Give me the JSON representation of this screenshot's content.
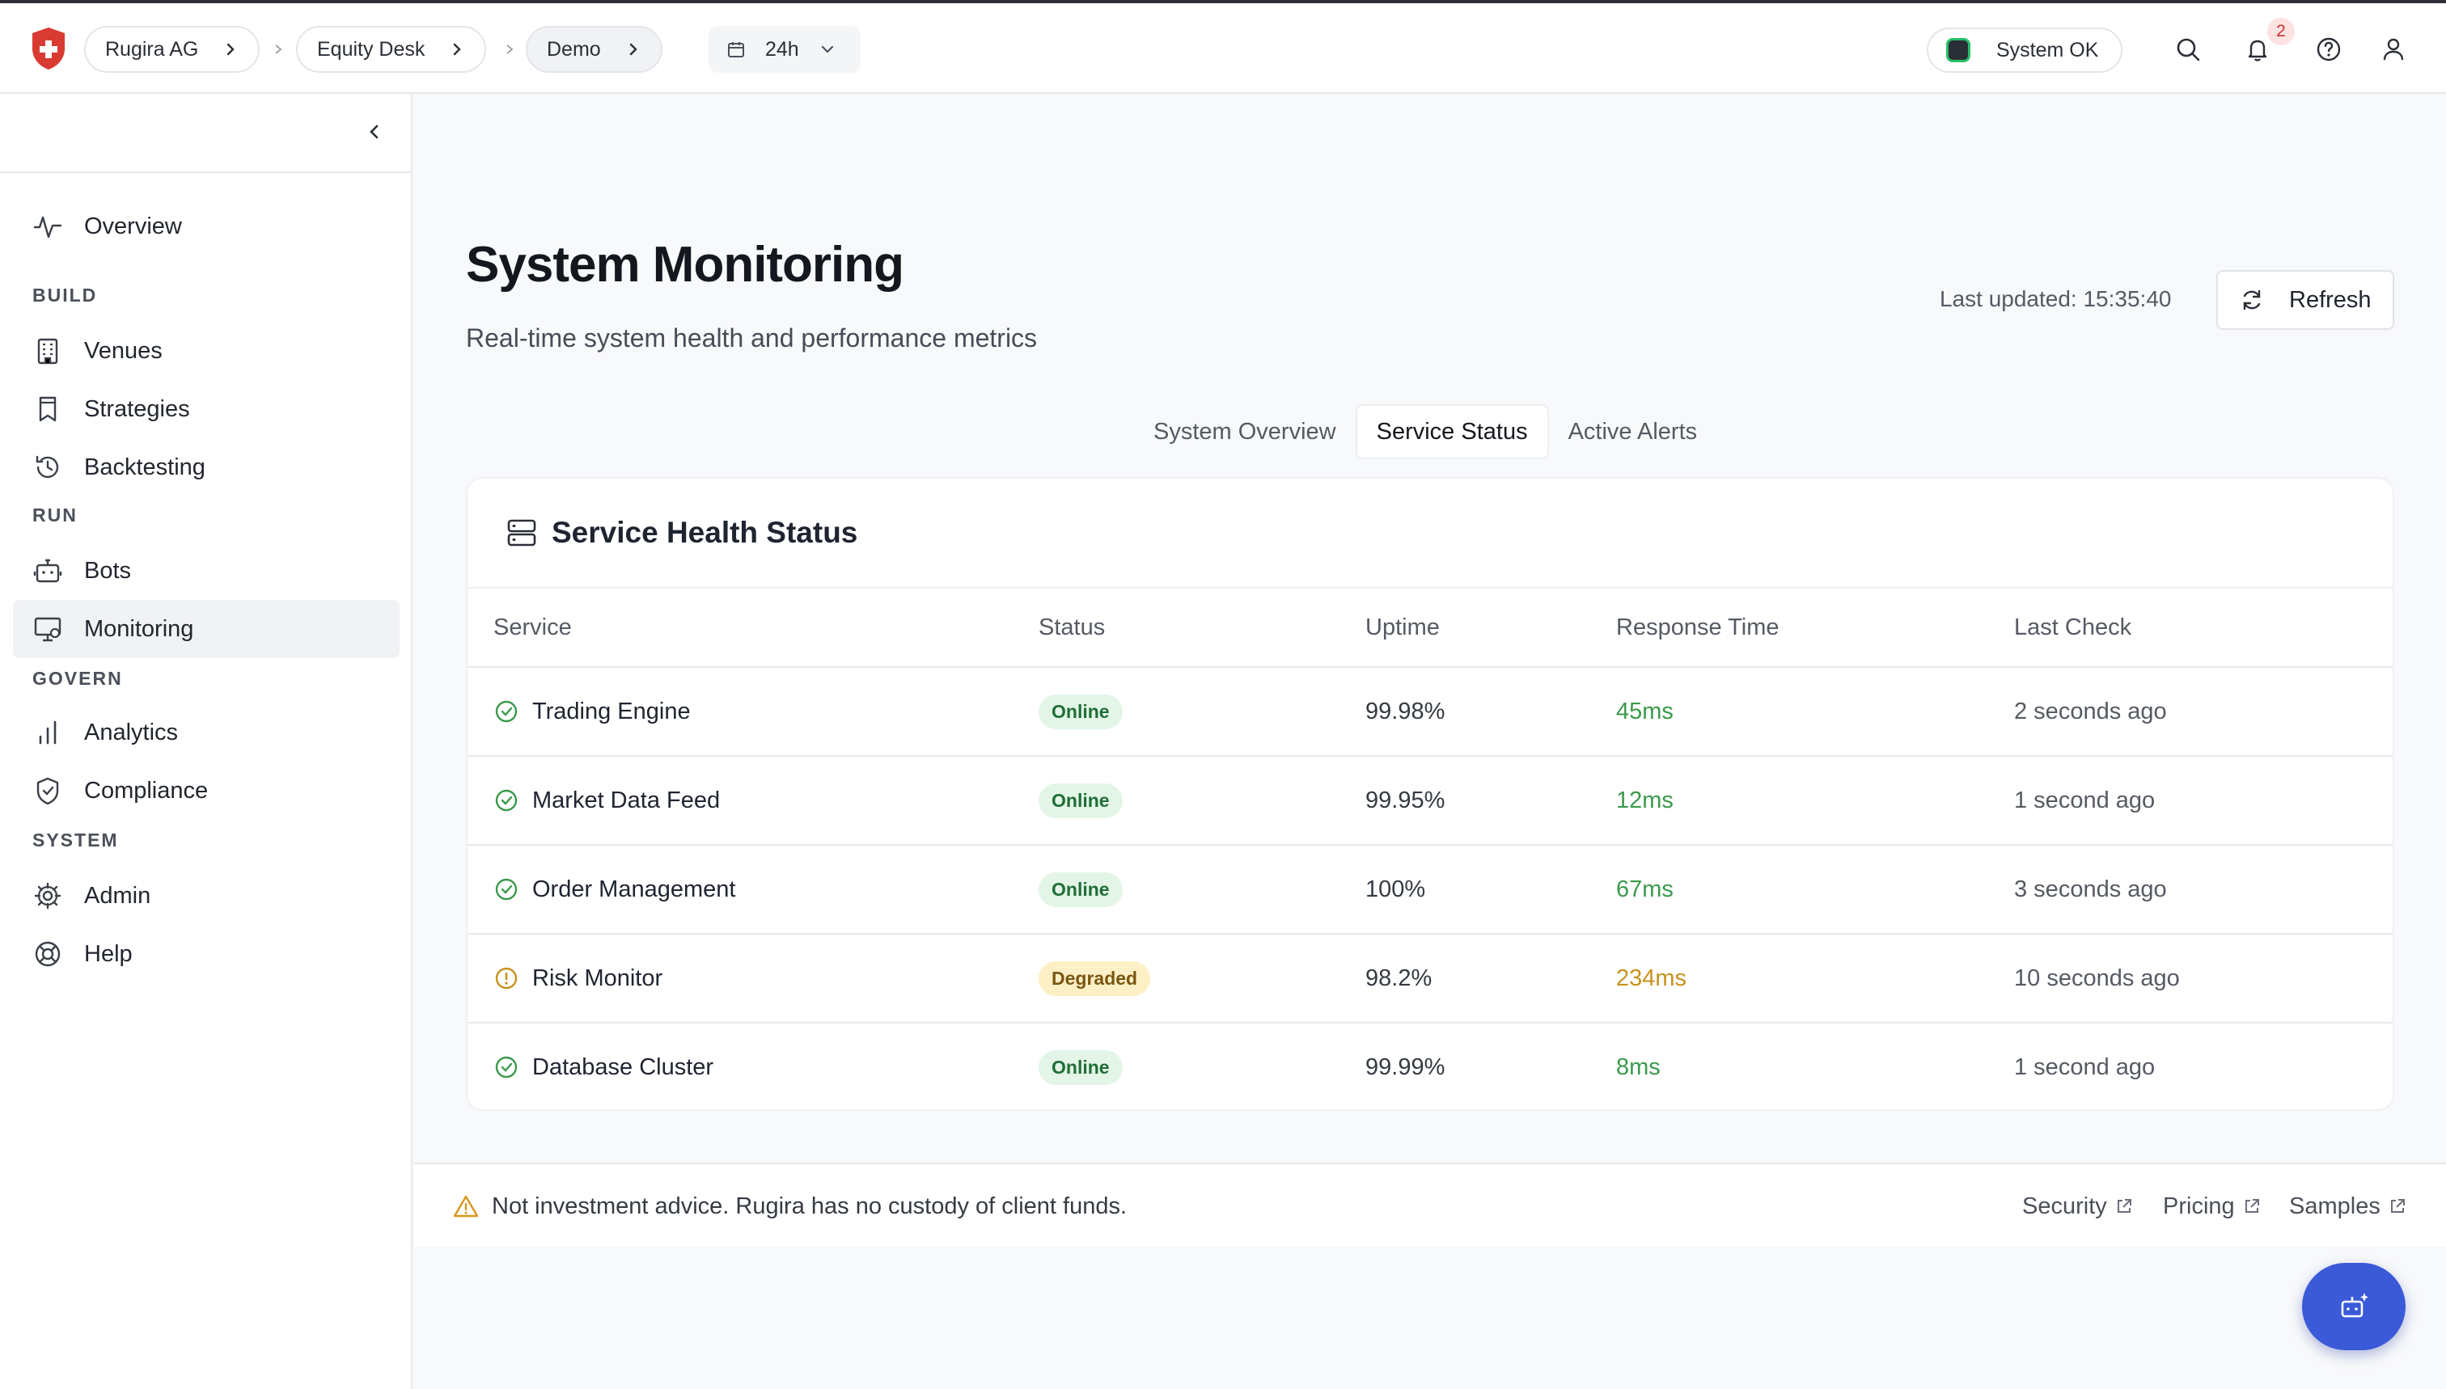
{
  "header": {
    "breadcrumbs": [
      "Rugira AG",
      "Equity Desk",
      "Demo"
    ],
    "time_range": "24h",
    "system_status": "System OK",
    "notification_count": "2"
  },
  "sidebar": {
    "overview": "Overview",
    "sections": {
      "build": "BUILD",
      "run": "RUN",
      "govern": "GOVERN",
      "system": "SYSTEM"
    },
    "items": {
      "venues": "Venues",
      "strategies": "Strategies",
      "backtesting": "Backtesting",
      "bots": "Bots",
      "monitoring": "Monitoring",
      "analytics": "Analytics",
      "compliance": "Compliance",
      "admin": "Admin",
      "help": "Help"
    }
  },
  "page": {
    "title": "System Monitoring",
    "subtitle": "Real-time system health and performance metrics",
    "last_updated": "Last updated: 15:35:40",
    "refresh_label": "Refresh"
  },
  "tabs": [
    "System Overview",
    "Service Status",
    "Active Alerts"
  ],
  "service_health": {
    "title": "Service Health Status",
    "columns": [
      "Service",
      "Status",
      "Uptime",
      "Response Time",
      "Last Check"
    ],
    "rows": [
      {
        "service": "Trading Engine",
        "status": "Online",
        "uptime": "99.98%",
        "response_time": "45ms",
        "last_check": "2 seconds ago"
      },
      {
        "service": "Market Data Feed",
        "status": "Online",
        "uptime": "99.95%",
        "response_time": "12ms",
        "last_check": "1 second ago"
      },
      {
        "service": "Order Management",
        "status": "Online",
        "uptime": "100%",
        "response_time": "67ms",
        "last_check": "3 seconds ago"
      },
      {
        "service": "Risk Monitor",
        "status": "Degraded",
        "uptime": "98.2%",
        "response_time": "234ms",
        "last_check": "10 seconds ago"
      },
      {
        "service": "Database Cluster",
        "status": "Online",
        "uptime": "99.99%",
        "response_time": "8ms",
        "last_check": "1 second ago"
      }
    ]
  },
  "footer": {
    "disclaimer": "Not investment advice. Rugira has no custody of client funds.",
    "links": [
      "Security",
      "Pricing",
      "Samples"
    ]
  },
  "colors": {
    "brand_red": "#d93a32",
    "online_green": "#3b9a4b",
    "degraded_amber": "#c8921c",
    "fab_blue": "#3a5ad8"
  }
}
